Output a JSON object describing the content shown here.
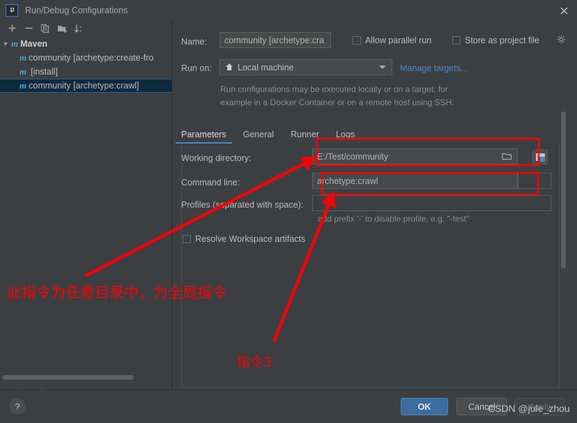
{
  "window": {
    "title": "Run/Debug Configurations",
    "app_icon": "intellij-idea-icon",
    "close_icon": "close-icon"
  },
  "toolbar": {
    "add": "+",
    "remove": "−",
    "copy_icon": "copy-icon",
    "folder_icon": "add-folder-icon",
    "sort_icon": "sort-alphabetical-icon"
  },
  "sidebar": {
    "group": {
      "label": "Maven",
      "expanded_icon": "chevron-down-icon",
      "type_icon": "maven-icon"
    },
    "items": [
      {
        "label": "community [archetype:create-fro",
        "selected": false,
        "icon": "maven-icon"
      },
      {
        "label": "[install]",
        "selected": false,
        "icon": "maven-icon"
      },
      {
        "label": "community [archetype:crawl]",
        "selected": true,
        "icon": "maven-icon"
      }
    ],
    "edit_templates_link": "Edit configuration templates..."
  },
  "form": {
    "name_label": "Name:",
    "name_value": "community [archetype:cra",
    "allow_parallel_run": "Allow parallel run",
    "allow_parallel_run_checked": false,
    "store_as_project_file": "Store as project file",
    "store_as_project_file_checked": false,
    "gear_icon": "gear-icon",
    "run_on_label": "Run on:",
    "run_on_value": "Local machine",
    "run_on_icon": "home-icon",
    "manage_targets_link": "Manage targets...",
    "description_line1": "Run configurations may be executed locally or on a target: for",
    "description_line2": "example in a Docker Container or on a remote host using SSH."
  },
  "tabs": [
    {
      "label": "Parameters",
      "active": true
    },
    {
      "label": "General",
      "active": false
    },
    {
      "label": "Runner",
      "active": false
    },
    {
      "label": "Logs",
      "active": false
    }
  ],
  "parameters": {
    "working_directory_label": "Working directory:",
    "working_directory_value": "E:/Test/community",
    "browse_icon": "folder-browse-icon",
    "macro_icon": "insert-macro-icon",
    "command_line_label": "Command line:",
    "command_line_value": "archetype:crawl",
    "profiles_label": "Profiles (separated with space):",
    "profiles_value": "",
    "profiles_hint": "add prefix '-' to disable profile, e.g. \"-test\"",
    "resolve_workspace_artifacts": "Resolve Workspace artifacts",
    "resolve_workspace_artifacts_checked": false
  },
  "footer": {
    "help_icon": "help-icon",
    "ok": "OK",
    "cancel": "Cancel",
    "apply": "Apply",
    "apply_disabled": true
  },
  "annotations": {
    "color": "#fb0007",
    "note_global": "此指令为任意目录中，为全局指令",
    "note_command3": "指令3",
    "highlight_boxes": [
      "working-directory-highlight",
      "command-line-highlight"
    ],
    "watermark": "CSDN @jule_zhou"
  },
  "colors": {
    "background": "#3c3f41",
    "field_background": "#45494a",
    "accent": "#4a88c7",
    "selection": "#0d293e",
    "annotation_red": "#fb0007",
    "maven_icon": "#4ba3d4"
  }
}
